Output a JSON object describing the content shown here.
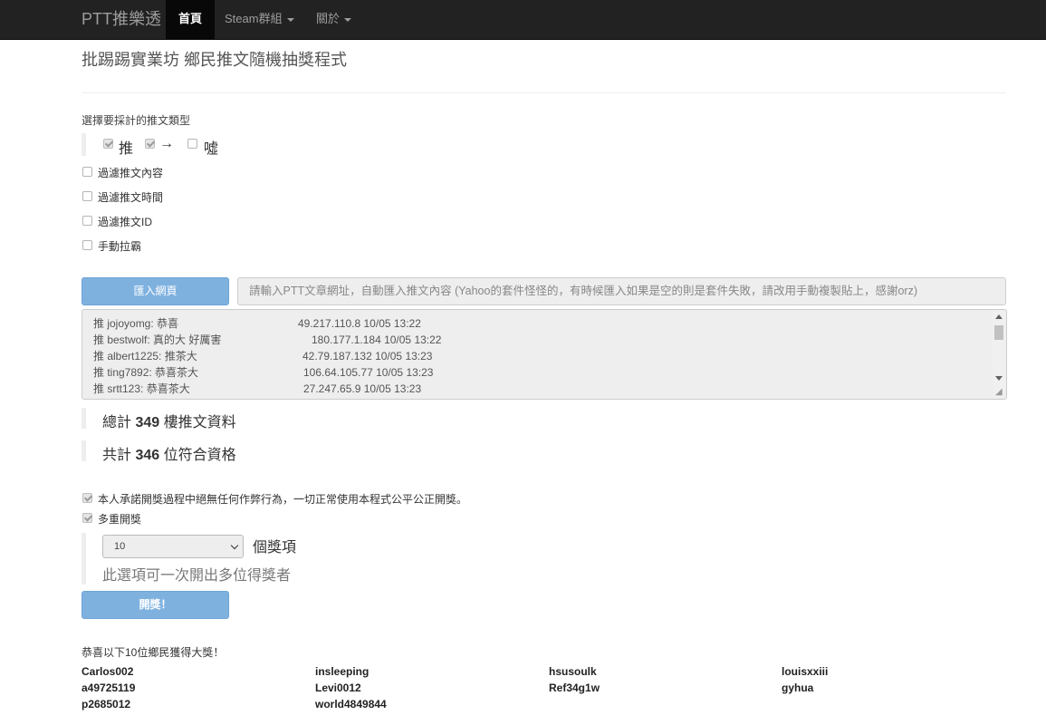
{
  "navbar": {
    "brand": "PTT推樂透",
    "items": [
      {
        "label": "首頁",
        "active": true
      },
      {
        "label": "Steam群組",
        "dropdown": true
      },
      {
        "label": "關於",
        "dropdown": true
      }
    ]
  },
  "page_title": "批踢踢實業坊 鄉民推文隨機抽獎程式",
  "push_types": {
    "heading": "選擇要採計的推文類型",
    "options": [
      {
        "label": "推",
        "checked": true
      },
      {
        "label": "→",
        "checked": true
      },
      {
        "label": "噓",
        "checked": false
      }
    ]
  },
  "filters": [
    {
      "label": "過濾推文內容",
      "checked": false
    },
    {
      "label": "過濾推文時間",
      "checked": false
    },
    {
      "label": "過濾推文ID",
      "checked": false
    },
    {
      "label": "手動拉霸",
      "checked": false
    }
  ],
  "import": {
    "button_label": "匯入網頁",
    "placeholder": "請輸入PTT文章網址，自動匯入推文內容 (Yahoo的套件怪怪的，有時候匯入如果是空的則是套件失敗，請改用手動複製貼上，感謝orz)"
  },
  "pushes": [
    {
      "text": "推 jojoyomg: 恭喜",
      "meta": "49.217.110.8 10/05 13:22"
    },
    {
      "text": "推 bestwolf: 真的大 好厲害",
      "meta": "180.177.1.184 10/05 13:22"
    },
    {
      "text": "推 albert1225: 推茶大",
      "meta": "42.79.187.132 10/05 13:23"
    },
    {
      "text": "推 ting7892: 恭喜茶大",
      "meta": "106.64.105.77 10/05 13:23"
    },
    {
      "text": "推 srtt123: 恭喜茶大",
      "meta": "27.247.65.9 10/05 13:23"
    }
  ],
  "stats": {
    "total_prefix": "總計",
    "total_count": "349",
    "total_suffix": "樓推文資料",
    "eligible_prefix": "共計",
    "eligible_count": "346",
    "eligible_suffix": "位符合資格"
  },
  "options": {
    "promise_label": "本人承諾開獎過程中絕無任何作弊行為，一切正常使用本程式公平公正開獎。",
    "promise_checked": true,
    "multi_label": "多重開獎",
    "multi_checked": true,
    "prize_count": "10",
    "prize_unit": "個獎項",
    "prize_hint": "此選項可一次開出多位得獎者"
  },
  "draw_button_label": "開獎！",
  "winners": {
    "title": "恭喜以下10位鄉民獲得大獎！",
    "names": [
      "Carlos002",
      "insleeping",
      "hsusoulk",
      "louisxxiii",
      "a49725119",
      "Levi0012",
      "Ref34g1w",
      "gyhua",
      "p2685012",
      "world4849844"
    ]
  }
}
